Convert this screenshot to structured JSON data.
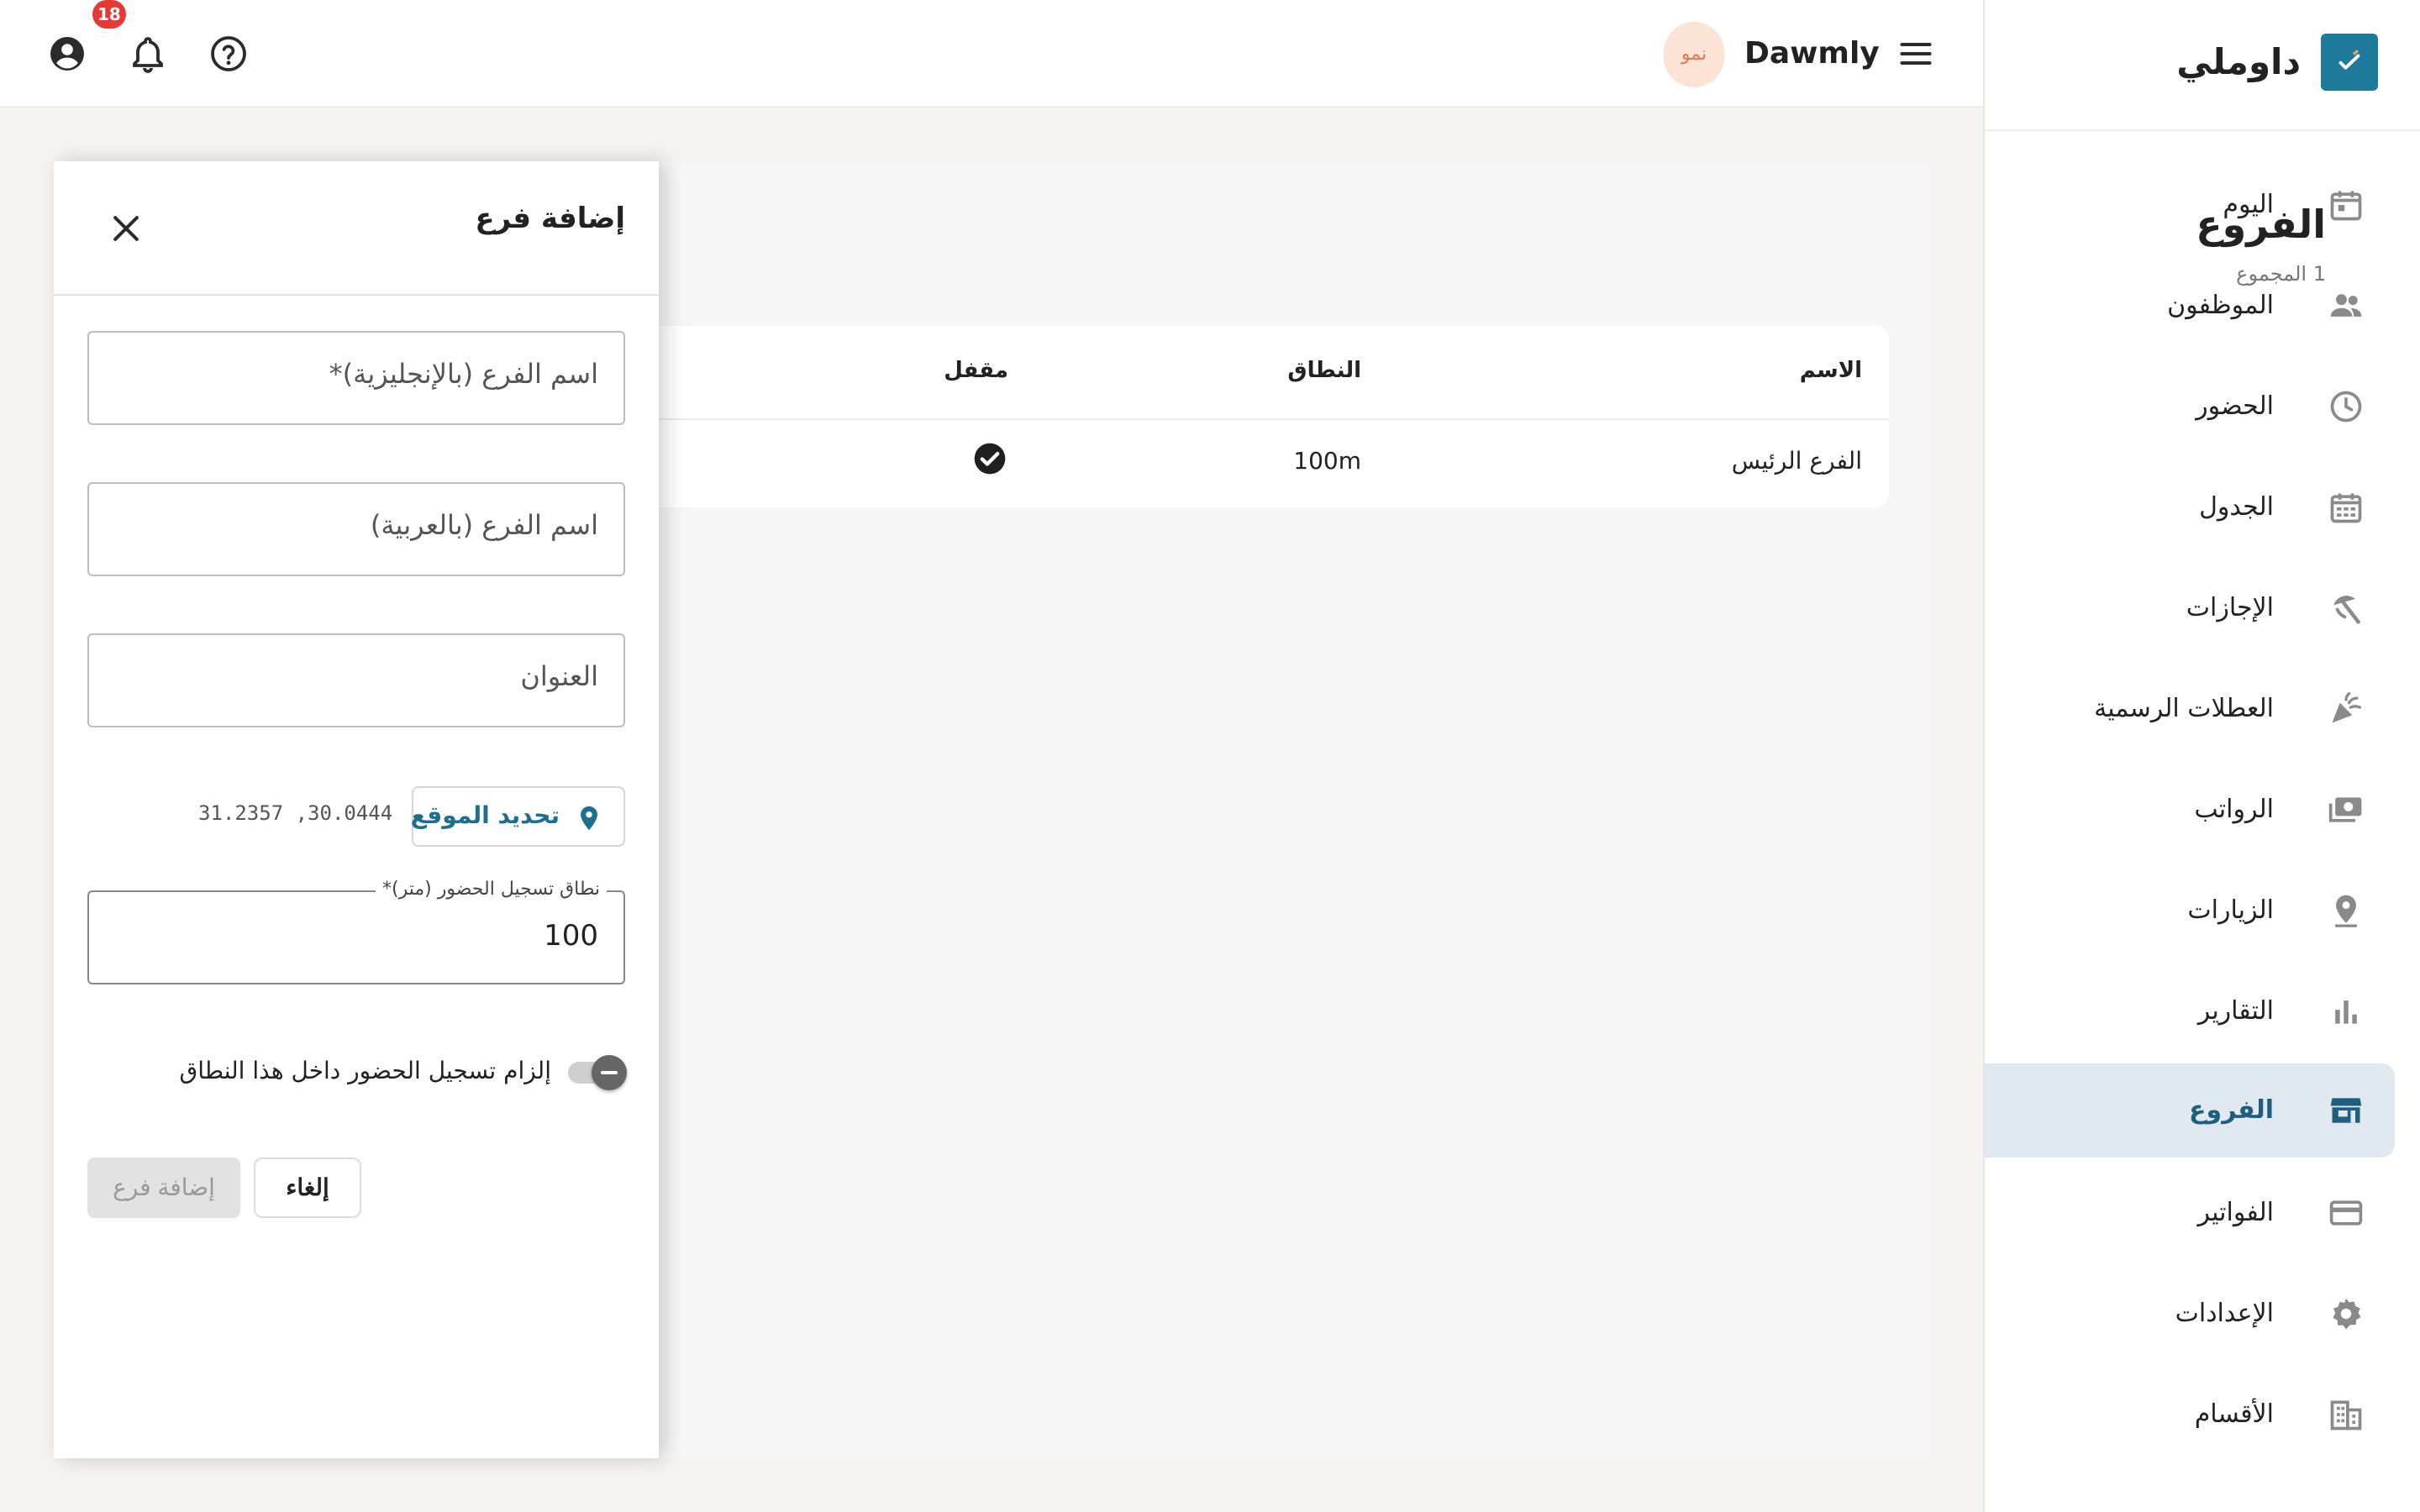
{
  "sidebar": {
    "brand": "داوملي",
    "items": [
      {
        "label": "اليوم",
        "icon": "calendar-today-icon"
      },
      {
        "label": "الموظفون",
        "icon": "people-icon"
      },
      {
        "label": "الحضور",
        "icon": "clock-icon"
      },
      {
        "label": "الجدول",
        "icon": "calendar-grid-icon"
      },
      {
        "label": "الإجازات",
        "icon": "beach-umbrella-icon"
      },
      {
        "label": "العطلات الرسمية",
        "icon": "celebration-icon"
      },
      {
        "label": "الرواتب",
        "icon": "payments-icon"
      },
      {
        "label": "الزيارات",
        "icon": "location-pin-icon"
      },
      {
        "label": "التقارير",
        "icon": "bar-chart-icon"
      },
      {
        "label": "الفروع",
        "icon": "storefront-icon",
        "active": true
      },
      {
        "label": "الفواتير",
        "icon": "credit-card-icon"
      },
      {
        "label": "الإعدادات",
        "icon": "gear-icon"
      },
      {
        "label": "الأقسام",
        "icon": "building-icon"
      }
    ]
  },
  "topbar": {
    "title": "Dawmly",
    "logo_text": "نمو",
    "notification_count": "18"
  },
  "main": {
    "title": "الفروع",
    "subtitle": "1 المجموع",
    "table": {
      "headers": {
        "name": "الاسم",
        "range": "النطاق",
        "locked": "مقفل"
      },
      "rows": [
        {
          "name": "الفرع الرئيس",
          "range": "100m",
          "locked": true
        }
      ]
    }
  },
  "drawer": {
    "title": "إضافة فرع",
    "fields": {
      "name_en_placeholder": "اسم الفرع (بالإنجليزية)*",
      "name_ar_placeholder": "اسم الفرع (بالعربية)",
      "address_placeholder": "العنوان"
    },
    "location_button": "تحديد الموقع",
    "coordinates": "31.2357 ,30.0444",
    "range_label": "نطاق تسجيل الحضور (متر)*",
    "range_value": "100",
    "toggle_label": "إلزام تسجيل الحضور داخل هذا النطاق",
    "toggle_on": false,
    "cancel_button": "إلغاء",
    "submit_button": "إضافة فرع"
  },
  "colors": {
    "accent": "#1e7a9b",
    "active_nav_bg": "#dfe9ef",
    "badge": "#e53935"
  }
}
